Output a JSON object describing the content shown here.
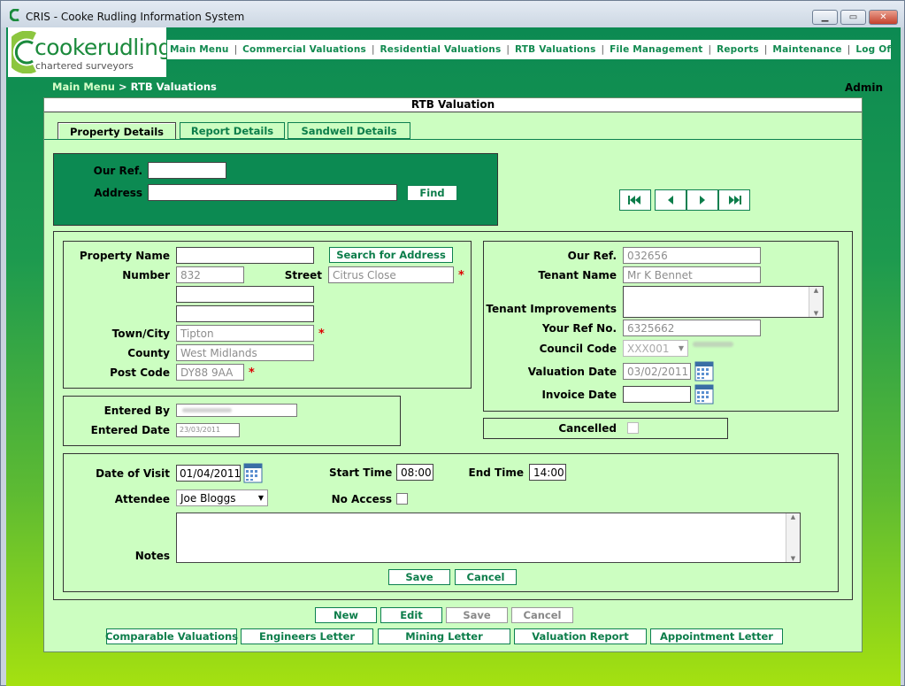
{
  "window": {
    "title": "CRIS - Cooke Rudling Information System"
  },
  "logo": {
    "name": "cookerudling",
    "tagline": "chartered surveyors"
  },
  "nav": [
    "Main Menu",
    "Commercial Valuations",
    "Residential Valuations",
    "RTB Valuations",
    "File Management",
    "Reports",
    "Maintenance",
    "Log Off"
  ],
  "breadcrumb": {
    "parent": "Main Menu",
    "separator": ">",
    "current": "RTB Valuations"
  },
  "user": "Admin",
  "panel": {
    "title": "RTB Valuation"
  },
  "tabs": [
    "Property Details",
    "Report Details",
    "Sandwell Details"
  ],
  "search": {
    "our_ref_label": "Our Ref.",
    "our_ref": "",
    "address_label": "Address",
    "address": "",
    "find": "Find"
  },
  "property": {
    "name_label": "Property Name",
    "name": "",
    "search_address_btn": "Search for Address",
    "number_label": "Number",
    "number": "832",
    "street_label": "Street",
    "street": "Citrus Close",
    "line2": "",
    "line3": "",
    "town_label": "Town/City",
    "town": "Tipton",
    "county_label": "County",
    "county": "West Midlands",
    "postcode_label": "Post Code",
    "postcode": "DY88 9AA",
    "required_mark": "*"
  },
  "tenant": {
    "our_ref_label": "Our Ref.",
    "our_ref": "032656",
    "tenant_name_label": "Tenant Name",
    "tenant_name": "Mr K Bennet",
    "improvements_label": "Tenant Improvements",
    "improvements": "",
    "your_ref_label": "Your Ref No.",
    "your_ref": "6325662",
    "council_label": "Council Code",
    "council_code": "XXX001",
    "valuation_date_label": "Valuation Date",
    "valuation_date": "03/02/2011",
    "invoice_date_label": "Invoice Date",
    "invoice_date": ""
  },
  "entered": {
    "by_label": "Entered By",
    "by": "",
    "date_label": "Entered Date",
    "date": "23/03/2011"
  },
  "cancelled": {
    "label": "Cancelled"
  },
  "visit": {
    "date_label": "Date of Visit",
    "date": "01/04/2011",
    "start_label": "Start Time",
    "start": "08:00",
    "end_label": "End Time",
    "end": "14:00",
    "attendee_label": "Attendee",
    "attendee": "Joe Bloggs",
    "no_access_label": "No Access",
    "notes_label": "Notes",
    "notes": "",
    "save": "Save",
    "cancel": "Cancel"
  },
  "actions": [
    "New",
    "Edit",
    "Save",
    "Cancel"
  ],
  "footer": [
    "Comparable Valuations",
    "Engineers Letter",
    "Mining Letter",
    "Valuation Report",
    "Appointment Letter"
  ],
  "colors": {
    "brand_green": "#0c8a52",
    "panel_bg": "#ccfec1",
    "required": "#dd0000",
    "logo_lime": "#8cc63f"
  }
}
